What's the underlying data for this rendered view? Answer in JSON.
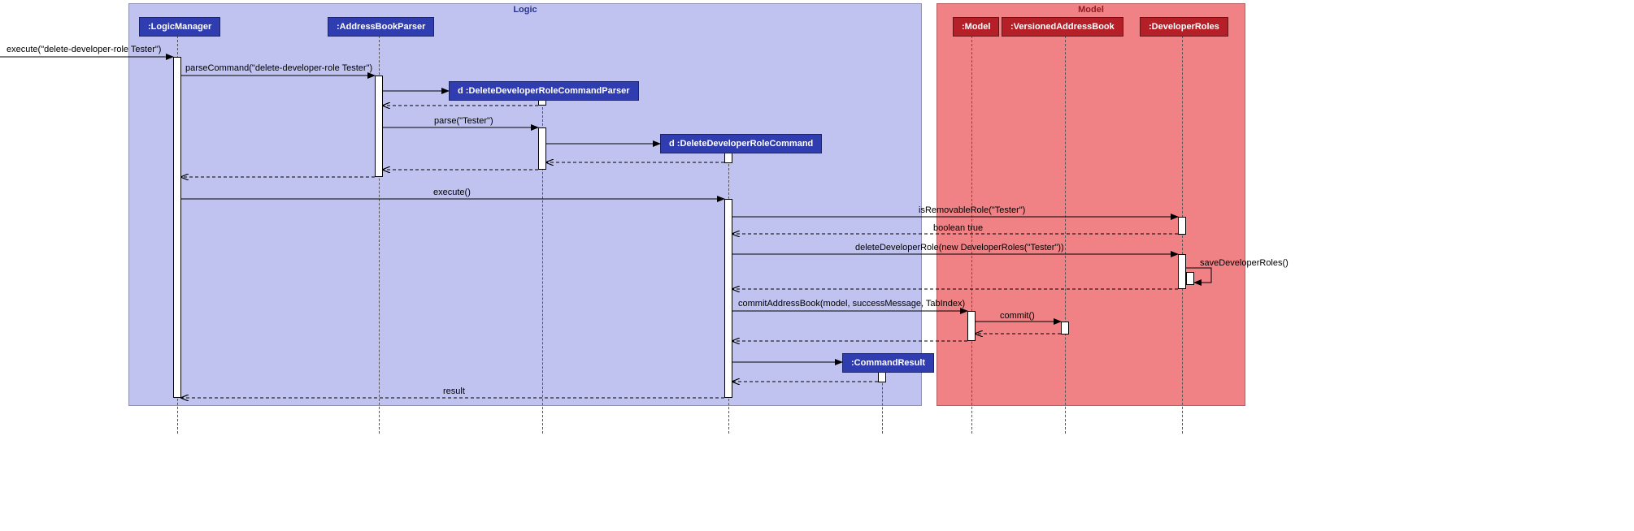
{
  "regions": {
    "logic_title": "Logic",
    "model_title": "Model"
  },
  "participants": {
    "logic_manager": ":LogicManager",
    "address_book_parser": ":AddressBookParser",
    "delete_dev_role_parser": "d :DeleteDeveloperRoleCommandParser",
    "delete_dev_role_cmd": "d :DeleteDeveloperRoleCommand",
    "command_result": ":CommandResult",
    "model": ":Model",
    "versioned_ab": ":VersionedAddressBook",
    "developer_roles": ":DeveloperRoles"
  },
  "messages": {
    "m1": "execute(\"delete-developer-role Tester\")",
    "m2": "parseCommand(\"delete-developer-role Tester\")",
    "m3": "parse(\"Tester\")",
    "m4": "execute()",
    "m5": "isRemovableRole(\"Tester\")",
    "m6": "boolean true",
    "m7": "deleteDeveloperRole(new DeveloperRoles(\"Tester\"))",
    "m8": "saveDeveloperRoles()",
    "m9": "commitAddressBook(model, successMessage, TabIndex)",
    "m10": "commit()",
    "m11": "result"
  },
  "chart_data": {
    "type": "sequence_diagram",
    "regions": [
      {
        "name": "Logic",
        "participants": [
          "LogicManager",
          "AddressBookParser",
          "DeleteDeveloperRoleCommandParser",
          "DeleteDeveloperRoleCommand",
          "CommandResult"
        ]
      },
      {
        "name": "Model",
        "participants": [
          "Model",
          "VersionedAddressBook",
          "DeveloperRoles"
        ]
      }
    ],
    "lifelines": [
      "LogicManager",
      "AddressBookParser",
      "DeleteDeveloperRoleCommandParser",
      "DeleteDeveloperRoleCommand",
      "CommandResult",
      "Model",
      "VersionedAddressBook",
      "DeveloperRoles"
    ],
    "interactions": [
      {
        "from": "external",
        "to": "LogicManager",
        "label": "execute(\"delete-developer-role Tester\")",
        "type": "sync"
      },
      {
        "from": "LogicManager",
        "to": "AddressBookParser",
        "label": "parseCommand(\"delete-developer-role Tester\")",
        "type": "sync"
      },
      {
        "from": "AddressBookParser",
        "to": "DeleteDeveloperRoleCommandParser",
        "label": "",
        "type": "create"
      },
      {
        "from": "DeleteDeveloperRoleCommandParser",
        "to": "AddressBookParser",
        "label": "",
        "type": "return"
      },
      {
        "from": "AddressBookParser",
        "to": "DeleteDeveloperRoleCommandParser",
        "label": "parse(\"Tester\")",
        "type": "sync"
      },
      {
        "from": "DeleteDeveloperRoleCommandParser",
        "to": "DeleteDeveloperRoleCommand",
        "label": "",
        "type": "create"
      },
      {
        "from": "DeleteDeveloperRoleCommand",
        "to": "DeleteDeveloperRoleCommandParser",
        "label": "",
        "type": "return"
      },
      {
        "from": "DeleteDeveloperRoleCommandParser",
        "to": "AddressBookParser",
        "label": "",
        "type": "return"
      },
      {
        "from": "AddressBookParser",
        "to": "LogicManager",
        "label": "",
        "type": "return"
      },
      {
        "from": "LogicManager",
        "to": "DeleteDeveloperRoleCommand",
        "label": "execute()",
        "type": "sync"
      },
      {
        "from": "DeleteDeveloperRoleCommand",
        "to": "DeveloperRoles",
        "label": "isRemovableRole(\"Tester\")",
        "type": "sync"
      },
      {
        "from": "DeveloperRoles",
        "to": "DeleteDeveloperRoleCommand",
        "label": "boolean true",
        "type": "return"
      },
      {
        "from": "DeleteDeveloperRoleCommand",
        "to": "DeveloperRoles",
        "label": "deleteDeveloperRole(new DeveloperRoles(\"Tester\"))",
        "type": "sync"
      },
      {
        "from": "DeveloperRoles",
        "to": "DeveloperRoles",
        "label": "saveDeveloperRoles()",
        "type": "self"
      },
      {
        "from": "DeveloperRoles",
        "to": "DeleteDeveloperRoleCommand",
        "label": "",
        "type": "return"
      },
      {
        "from": "DeleteDeveloperRoleCommand",
        "to": "Model",
        "label": "commitAddressBook(model, successMessage, TabIndex)",
        "type": "sync"
      },
      {
        "from": "Model",
        "to": "VersionedAddressBook",
        "label": "commit()",
        "type": "sync"
      },
      {
        "from": "VersionedAddressBook",
        "to": "Model",
        "label": "",
        "type": "return"
      },
      {
        "from": "Model",
        "to": "DeleteDeveloperRoleCommand",
        "label": "",
        "type": "return"
      },
      {
        "from": "DeleteDeveloperRoleCommand",
        "to": "CommandResult",
        "label": "",
        "type": "create"
      },
      {
        "from": "CommandResult",
        "to": "DeleteDeveloperRoleCommand",
        "label": "",
        "type": "return"
      },
      {
        "from": "DeleteDeveloperRoleCommand",
        "to": "LogicManager",
        "label": "result",
        "type": "return"
      }
    ]
  }
}
